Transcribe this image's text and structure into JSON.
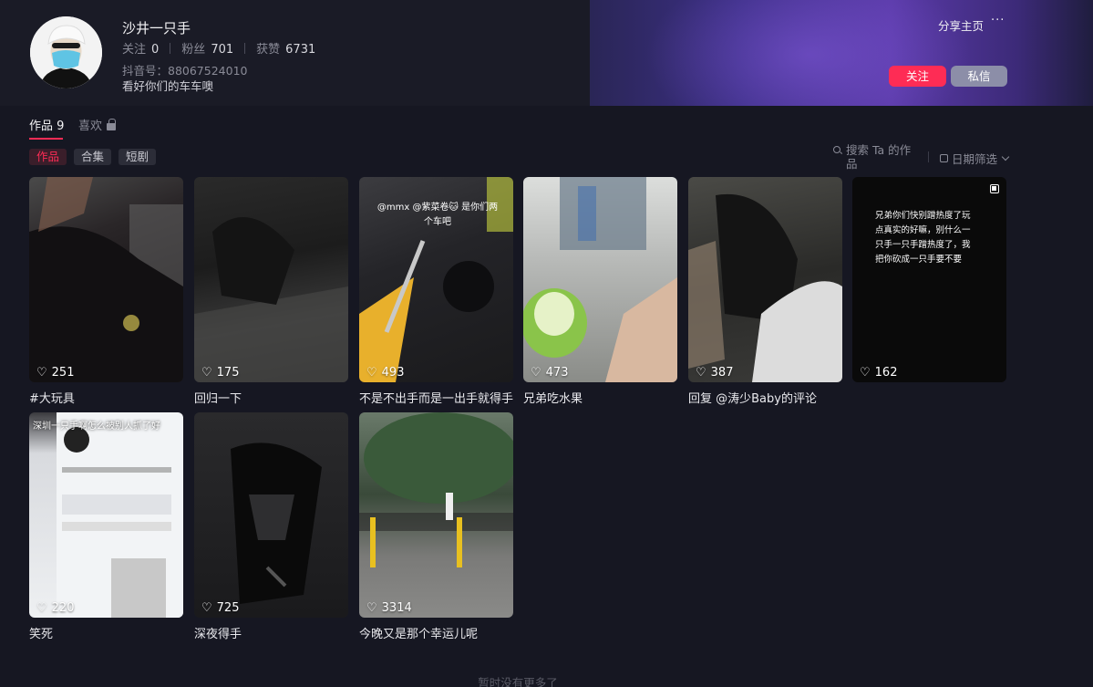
{
  "profile": {
    "nickname": "沙井一只手",
    "stats": [
      {
        "label": "关注",
        "value": "0"
      },
      {
        "label": "粉丝",
        "value": "701"
      },
      {
        "label": "获赞",
        "value": "6731"
      }
    ],
    "douyin_id": "抖音号：88067524010",
    "bio": "看好你们的车车噢"
  },
  "actions": {
    "share": "分享主页",
    "more": "···",
    "follow": "关注",
    "message": "私信"
  },
  "tabs": {
    "works": "作品 9",
    "likes": "喜欢"
  },
  "chips": [
    "作品",
    "合集",
    "短剧"
  ],
  "search_label": "搜索 Ta 的作品",
  "filter_label": "日期筛选",
  "videos": [
    {
      "likes": "251",
      "caption": "#大玩具"
    },
    {
      "likes": "175",
      "caption": "回归一下"
    },
    {
      "likes": "493",
      "caption": "不是不出手而是一出手就得手",
      "overlay": "@mmx @紫菜卷🐱 是你们两个车吧"
    },
    {
      "likes": "473",
      "caption": "兄弟吃水果"
    },
    {
      "likes": "387",
      "caption": "回复 @涛少Baby的评论"
    },
    {
      "likes": "162",
      "caption": "",
      "overlay": "兄弟你们快别蹭热度了玩点真实的好嘛，别什么一只手一只手蹭热度了，我把你砍成一只手要不要"
    },
    {
      "likes": "220",
      "caption": "笑死",
      "overlay": "深圳一只手啊怎么被别人抓了好"
    },
    {
      "likes": "725",
      "caption": "深夜得手"
    },
    {
      "likes": "3314",
      "caption": "今晚又是那个幸运儿呢"
    }
  ],
  "end_text": "暂时没有更多了",
  "colors": {
    "background": "#161722",
    "accent": "#fe2c55",
    "message_button": "#8c8ea8"
  }
}
